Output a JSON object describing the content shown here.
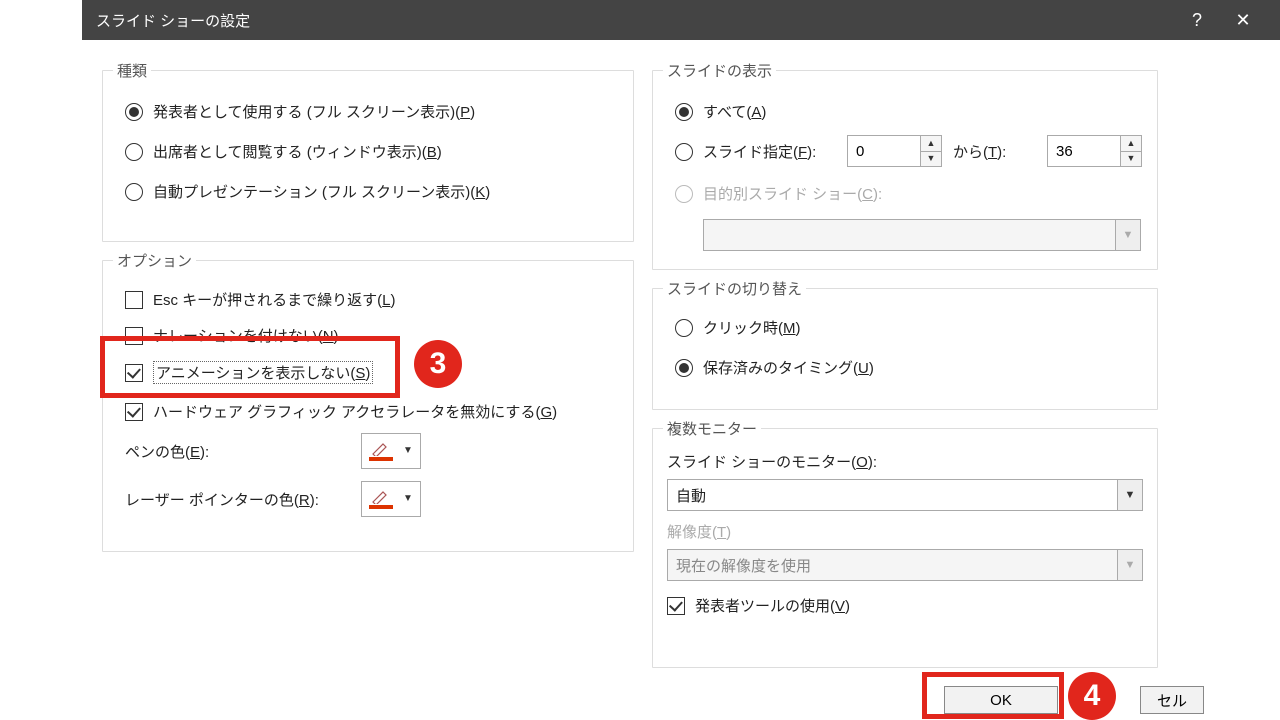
{
  "titlebar": {
    "title": "スライド ショーの設定",
    "help": "?",
    "close": "✕"
  },
  "fs": {
    "type": {
      "legend": "種類"
    },
    "options": {
      "legend": "オプション"
    },
    "show": {
      "legend": "スライドの表示"
    },
    "advance": {
      "legend": "スライドの切り替え"
    },
    "monitor": {
      "legend": "複数モニター"
    }
  },
  "type": {
    "r1_pre": "発表者として使用する (フル スクリーン表示)(",
    "r1_u": "P",
    "r1_post": ")",
    "r2_pre": "出席者として閲覧する (ウィンドウ表示)(",
    "r2_u": "B",
    "r2_post": ")",
    "r3_pre": "自動プレゼンテーション (フル スクリーン表示)(",
    "r3_u": "K",
    "r3_post": ")"
  },
  "options": {
    "c1_pre": "Esc キーが押されるまで繰り返す(",
    "c1_u": "L",
    "c1_post": ")",
    "c2_pre": "ナレーションを付けない(",
    "c2_u": "N",
    "c2_post": ")",
    "c3_pre": "アニメーションを表示しない(",
    "c3_u": "S",
    "c3_post": ")",
    "c4_pre": "ハードウェア グラフィック アクセラレータを無効にする(",
    "c4_u": "G",
    "c4_post": ")",
    "pen_pre": "ペンの色(",
    "pen_u": "E",
    "pen_post": "):",
    "laser_pre": "レーザー ポインターの色(",
    "laser_u": "R",
    "laser_post": "):"
  },
  "show": {
    "all_pre": "すべて(",
    "all_u": "A",
    "all_post": ")",
    "from_pre": "スライド指定(",
    "from_u": "F",
    "from_post": "):",
    "to_pre": "から(",
    "to_u": "T",
    "to_post": "):",
    "from_val": "0",
    "to_val": "36",
    "custom_pre": "目的別スライド ショー(",
    "custom_u": "C",
    "custom_post": "):"
  },
  "advance": {
    "r1_pre": "クリック時(",
    "r1_u": "M",
    "r1_post": ")",
    "r2_pre": "保存済みのタイミング(",
    "r2_u": "U",
    "r2_post": ")"
  },
  "monitor": {
    "mon_pre": "スライド ショーのモニター(",
    "mon_u": "O",
    "mon_post": "):",
    "mon_val": "自動",
    "res_pre": "解像度(",
    "res_u": "T",
    "res_post": ")",
    "res_val": "現在の解像度を使用",
    "pv_pre": "発表者ツールの使用(",
    "pv_u": "V",
    "pv_post": ")"
  },
  "footer": {
    "ok": "OK",
    "cancel": "セル"
  },
  "annotations": {
    "n3": "3",
    "n4": "4"
  }
}
